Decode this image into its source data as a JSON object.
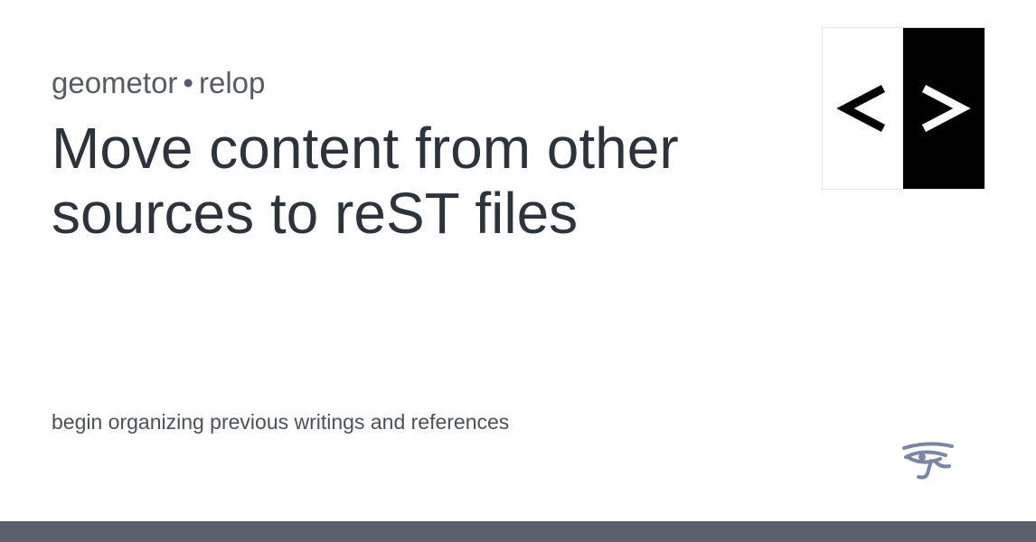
{
  "header": {
    "owner": "geometor",
    "separator": "•",
    "repo": "relop"
  },
  "title": "Move content from other sources to reST files",
  "description": "begin organizing previous writings and references",
  "icons": {
    "repo_logo": "code-brackets-icon",
    "site_mark": "eye-of-horus-icon"
  },
  "colors": {
    "background": "#ffffff",
    "title_text": "#2d333b",
    "footer_bar": "#5b616b",
    "eye_icon": "#7b86a4"
  }
}
